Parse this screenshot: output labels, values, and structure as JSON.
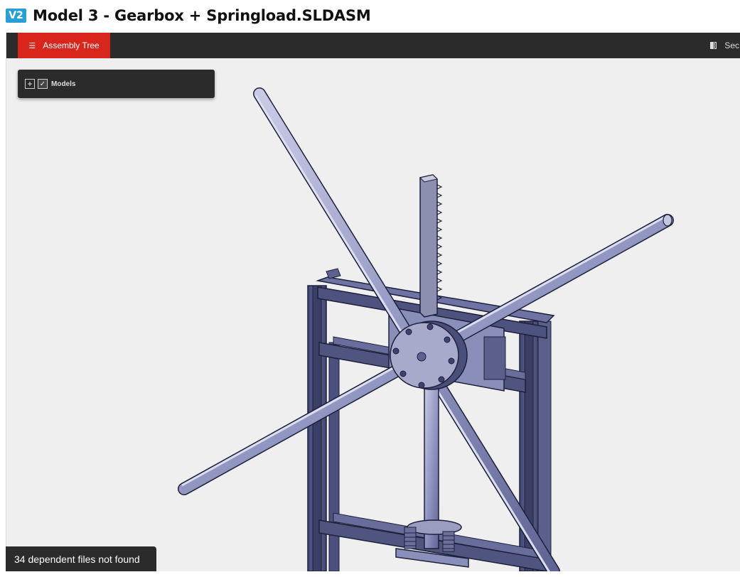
{
  "header": {
    "version_badge": "V2",
    "title": "Model 3 - Gearbox + Springload.SLDASM"
  },
  "toolbar": {
    "assembly_tree_label": "Assembly Tree",
    "section_label": "Sec"
  },
  "models_panel": {
    "expand_symbol": "+",
    "check_symbol": "✓",
    "label": "Models"
  },
  "status": {
    "message": "34 dependent files not found"
  },
  "colors": {
    "accent_red": "#d9261c",
    "toolbar_dark": "#2b2b2b",
    "badge_blue": "#2a9fd6",
    "viewport_bg": "#efefef",
    "frame_blue": "#4f5585",
    "rod_silver": "#9fa4cc"
  }
}
